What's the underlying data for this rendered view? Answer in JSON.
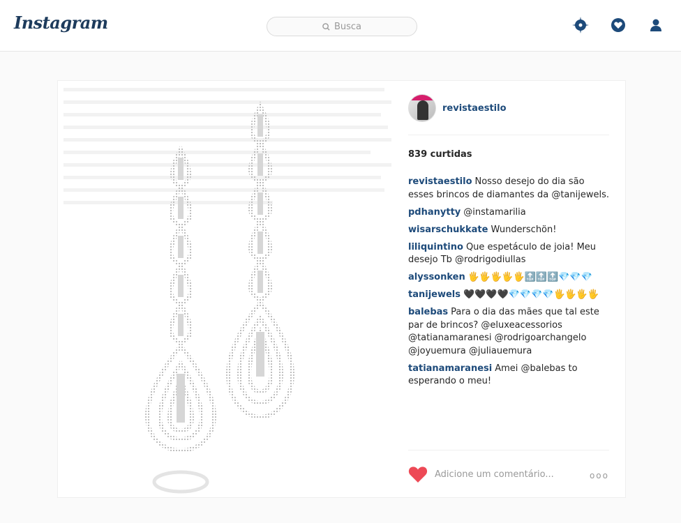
{
  "header": {
    "logo": "Instagram",
    "search_placeholder": "Busca",
    "icons": [
      "explore-icon",
      "activity-icon",
      "profile-icon"
    ]
  },
  "post": {
    "author": "revistaestilo",
    "likes": "839 curtidas",
    "comments": [
      {
        "user": "revistaestilo",
        "text": "Nosso desejo do dia são esses brincos de diamantes da @tanijewels."
      },
      {
        "user": "pdhanytty",
        "text": "@instamarilia"
      },
      {
        "user": "wisarschukkate",
        "text": "Wunderschön!"
      },
      {
        "user": "liliquintino",
        "text": "Que espetáculo de joia! Meu desejo Tb @rodrigodiullas"
      },
      {
        "user": "alyssonken",
        "text": "🖐🖐🖐🖐🖐🔝🔝🔝💎💎💎"
      },
      {
        "user": "tanijewels",
        "text": "🖤🖤🖤🖤💎💎💎💎🖐🖐🖐🖐"
      },
      {
        "user": "balebas",
        "text": "Para o dia das mães que tal este par de brincos? @eluxeacessorios @tatianamaranesi @rodrigoarchangelo @joyuemura @juliauemura"
      },
      {
        "user": "tatianamaranesi",
        "text": "Amei @balebas to esperando o meu!"
      }
    ],
    "comment_placeholder": "Adicione um comentário...",
    "more_label": "ooo"
  },
  "colors": {
    "brand": "#1d3b5c",
    "username": "#1d4a7a",
    "heart": "#ed4956"
  }
}
